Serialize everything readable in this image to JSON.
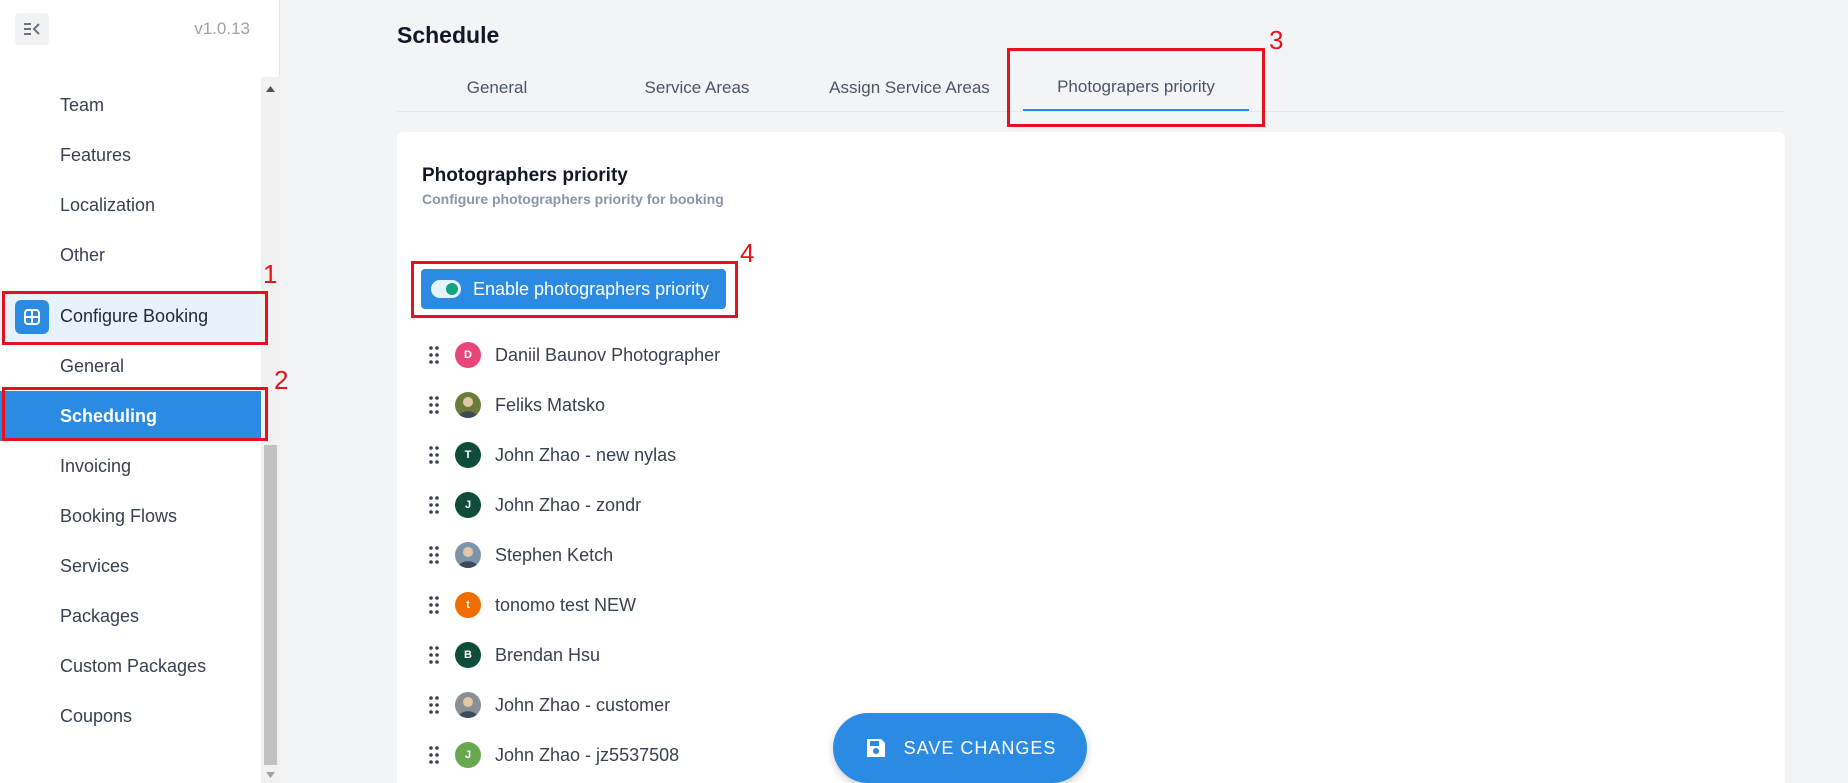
{
  "sidebar": {
    "version": "v1.0.13",
    "items": [
      {
        "label": "Team"
      },
      {
        "label": "Features"
      },
      {
        "label": "Localization"
      },
      {
        "label": "Other"
      },
      {
        "label": "Configure Booking"
      },
      {
        "label": "General"
      },
      {
        "label": "Scheduling"
      },
      {
        "label": "Invoicing"
      },
      {
        "label": "Booking Flows"
      },
      {
        "label": "Services"
      },
      {
        "label": "Packages"
      },
      {
        "label": "Custom Packages"
      },
      {
        "label": "Coupons"
      }
    ]
  },
  "page": {
    "title": "Schedule",
    "tabs": [
      {
        "label": "General"
      },
      {
        "label": "Service Areas"
      },
      {
        "label": "Assign Service Areas"
      },
      {
        "label": "Photograpers priority"
      }
    ]
  },
  "card": {
    "title": "Photographers priority",
    "subtitle": "Configure photographers priority for booking",
    "toggle_label": "Enable photographers priority",
    "toggle_on": true
  },
  "photographers": [
    {
      "name": "Daniil Baunov Photographer",
      "initial": "D",
      "color": "#e8457a"
    },
    {
      "name": "Feliks Matsko",
      "initial": "",
      "color": "#6b7c3a"
    },
    {
      "name": "John Zhao - new nylas",
      "initial": "T",
      "color": "#0f4c3a"
    },
    {
      "name": "John Zhao - zondr",
      "initial": "J",
      "color": "#0f4c3a"
    },
    {
      "name": "Stephen Ketch",
      "initial": "",
      "color": "#7f93a8"
    },
    {
      "name": "tonomo test NEW",
      "initial": "t",
      "color": "#ef6c00"
    },
    {
      "name": "Brendan Hsu",
      "initial": "B",
      "color": "#0f4c3a"
    },
    {
      "name": "John Zhao - customer",
      "initial": "",
      "color": "#8a8f96"
    },
    {
      "name": "John Zhao - jz5537508",
      "initial": "J",
      "color": "#6aa84f"
    }
  ],
  "footer": {
    "save_label": "SAVE CHANGES"
  },
  "annotations": [
    "1",
    "2",
    "3",
    "4"
  ],
  "colors": {
    "accent": "#2b8be3",
    "annotation": "#e5121b"
  }
}
